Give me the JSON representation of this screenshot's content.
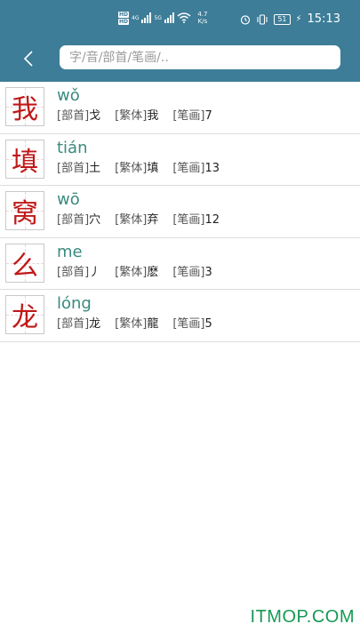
{
  "status_bar": {
    "hd1": "HD",
    "hd2": "HD",
    "net1": "4G",
    "net2": "5G",
    "speed_value": "4.7",
    "speed_unit": "K/s",
    "battery": "51",
    "time": "15:13"
  },
  "search": {
    "placeholder": "字/音/部首/笔画/.."
  },
  "labels": {
    "radical": "[部首]",
    "traditional": "[繁体]",
    "strokes": "[笔画]"
  },
  "results": [
    {
      "char": "我",
      "pinyin": "wǒ",
      "radical": "戈",
      "traditional": "我",
      "strokes": "7"
    },
    {
      "char": "填",
      "pinyin": "tián",
      "radical": "土",
      "traditional": "填",
      "strokes": "13"
    },
    {
      "char": "窝",
      "pinyin": "wō",
      "radical": "穴",
      "traditional": "弃",
      "strokes": "12"
    },
    {
      "char": "么",
      "pinyin": "me",
      "radical": "丿",
      "traditional": "麽",
      "strokes": "3"
    },
    {
      "char": "龙",
      "pinyin": "lóng",
      "radical": "龙",
      "traditional": "龍",
      "strokes": "5"
    }
  ],
  "watermark": "ITMOP.COM",
  "colors": {
    "header": "#3d7d98",
    "char": "#c01818",
    "pinyin": "#3a8a7e",
    "watermark": "#159a53"
  }
}
